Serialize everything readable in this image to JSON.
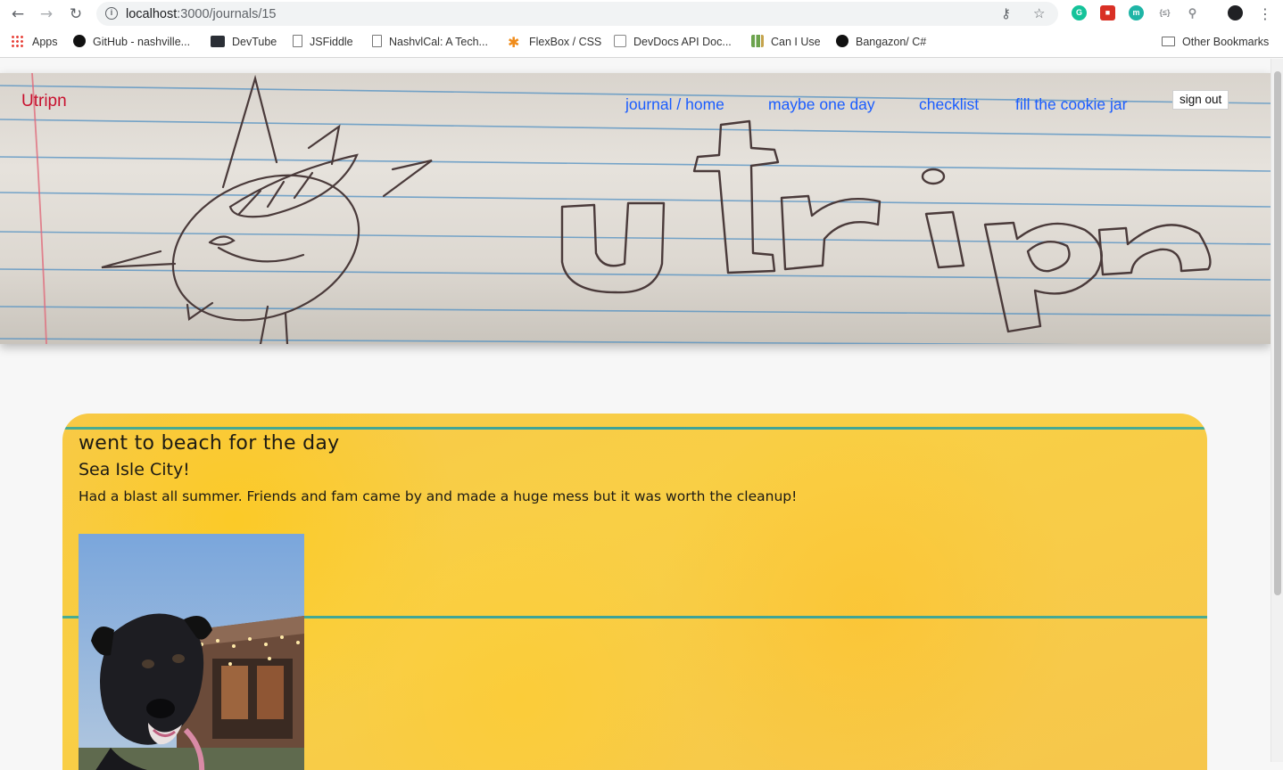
{
  "browser": {
    "url_host": "localhost",
    "url_path": ":3000/journals/15",
    "back_icon": "arrow-left-icon",
    "forward_icon": "arrow-right-icon",
    "reload_icon": "reload-icon"
  },
  "bookmarks": [
    {
      "label": "Apps",
      "icon": "apps-grid-icon"
    },
    {
      "label": "GitHub - nashville...",
      "icon": "github-icon"
    },
    {
      "label": "DevTube",
      "icon": "devtube-icon"
    },
    {
      "label": "JSFiddle",
      "icon": "page-icon"
    },
    {
      "label": "NashvlCal: A Tech...",
      "icon": "page-icon"
    },
    {
      "label": "FlexBox / CSS",
      "icon": "asterisk-icon"
    },
    {
      "label": "DevDocs API Doc...",
      "icon": "devdocs-icon"
    },
    {
      "label": "Can I Use",
      "icon": "caniuse-icon"
    },
    {
      "label": "Bangazon/ C#",
      "icon": "github-icon"
    },
    {
      "label": "Other Bookmarks",
      "icon": "folder-icon"
    }
  ],
  "app": {
    "brand": "Utripn",
    "nav": [
      {
        "label": "journal / home"
      },
      {
        "label": "maybe one day"
      },
      {
        "label": "checklist"
      },
      {
        "label": "fill the cookie jar"
      }
    ],
    "sign_out": "sign out"
  },
  "journal": {
    "title": "went to beach for the day",
    "location": "Sea Isle City!",
    "body": "Had a blast all summer. Friends and fam came by and made a huge mess but it was worth the cleanup!"
  },
  "colors": {
    "brand": "#c8102e",
    "nav_link": "#1a5cff",
    "card_yellow": "#f7c94a",
    "rule_teal": "#1b9aa8"
  }
}
